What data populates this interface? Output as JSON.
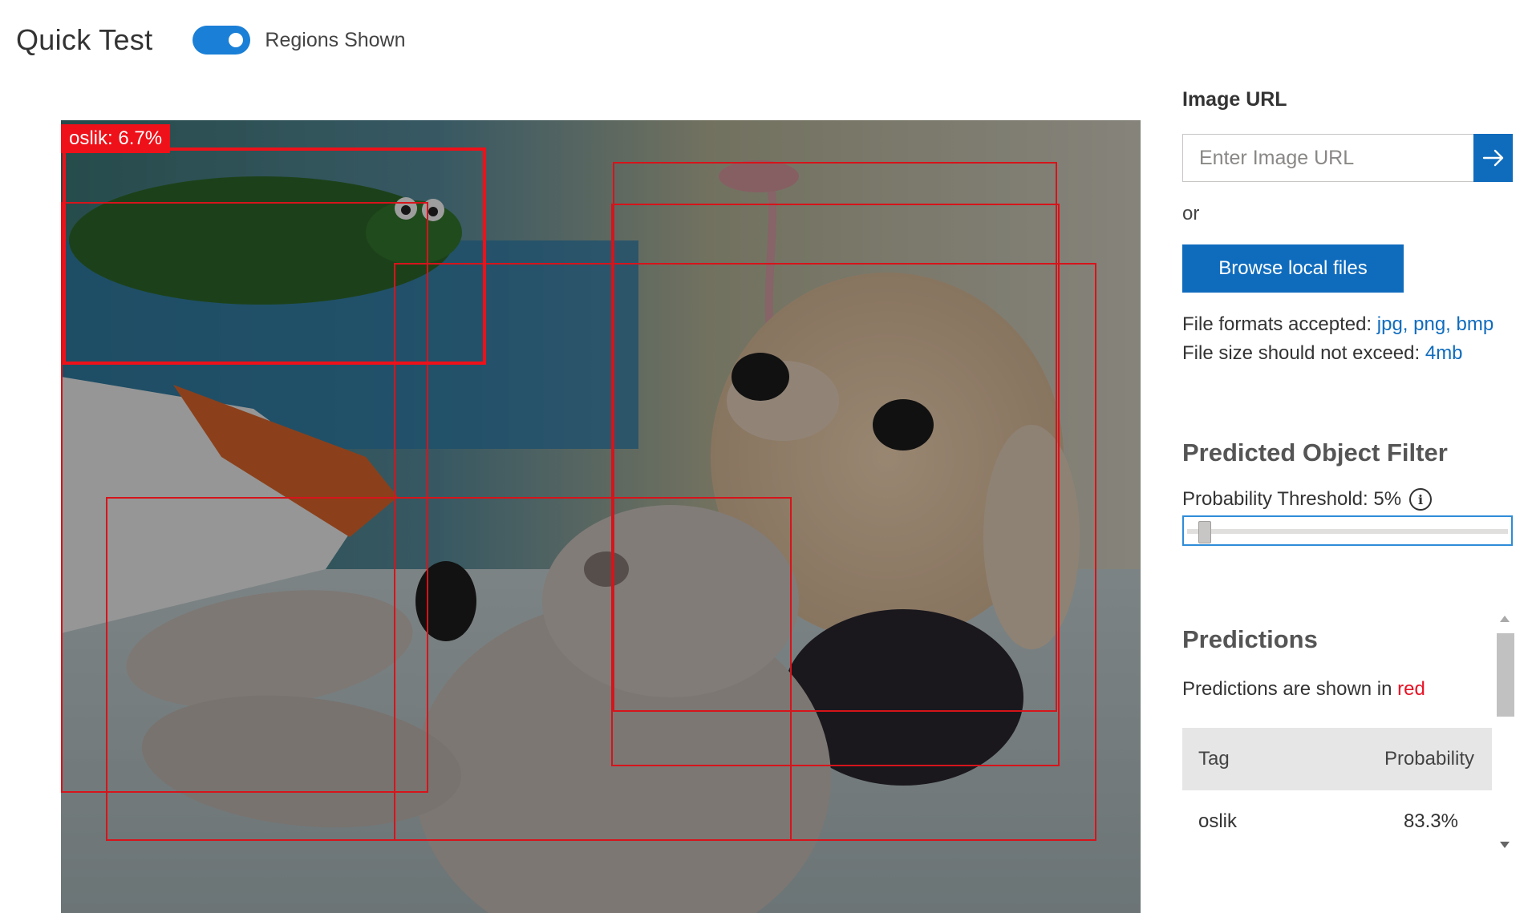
{
  "header": {
    "title": "Quick Test",
    "toggle_label": "Regions Shown",
    "toggle_on": true
  },
  "viewer": {
    "selected_region_label": "oslik: 6.7%",
    "region_color": "#ee1119"
  },
  "panel": {
    "image_url_label": "Image URL",
    "url_placeholder": "Enter Image URL",
    "or_text": "or",
    "browse_label": "Browse local files",
    "formats_prefix": "File formats accepted: ",
    "formats_value": "jpg, png, bmp",
    "size_prefix": "File size should not exceed: ",
    "size_value": "4mb",
    "filter_title": "Predicted Object Filter",
    "threshold_label": "Probability Threshold: 5%",
    "threshold_value_percent": 5,
    "predictions_title": "Predictions",
    "predictions_sub_prefix": "Predictions are shown in ",
    "predictions_sub_color_word": "red",
    "table": {
      "headers": [
        "Tag",
        "Probability"
      ],
      "rows": [
        {
          "tag": "oslik",
          "probability": "83.3%"
        }
      ]
    }
  },
  "colors": {
    "accent": "#0f6cbd",
    "toggle": "#1a7fd6",
    "prediction": "#e81123"
  }
}
